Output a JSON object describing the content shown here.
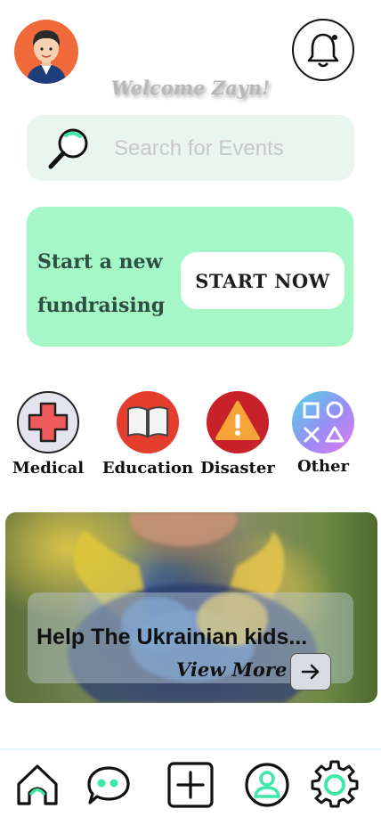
{
  "header": {
    "welcome_text": "Welcome Zayn!",
    "avatar_icon": "user-avatar",
    "notification_icon": "bell-icon"
  },
  "search": {
    "placeholder": "Search for Events",
    "icon": "search-icon"
  },
  "fundraising": {
    "text": "Start a new fundraising",
    "button_label": "START NOW",
    "background": "#a6f7c8"
  },
  "categories": [
    {
      "label": "Medical",
      "icon": "medical-cross-icon",
      "color": "#ef5a5a"
    },
    {
      "label": "Education",
      "icon": "book-icon",
      "color": "#e53d2e"
    },
    {
      "label": "Disaster",
      "icon": "warning-icon",
      "color": "#c8212a"
    },
    {
      "label": "Other",
      "icon": "playstation-shapes-icon",
      "color": "#8aa6f5"
    }
  ],
  "banner": {
    "title": "Help The Ukrainian kids...",
    "link_label": "View More",
    "arrow_icon": "arrow-right-icon"
  },
  "bottom_nav": [
    {
      "name": "home",
      "icon": "home-icon",
      "active": true
    },
    {
      "name": "chat",
      "icon": "chat-icon",
      "active": false
    },
    {
      "name": "add",
      "icon": "plus-square-icon",
      "active": false
    },
    {
      "name": "profile",
      "icon": "profile-icon",
      "active": false
    },
    {
      "name": "settings",
      "icon": "gear-icon",
      "active": false
    }
  ],
  "colors": {
    "accent": "#3ee8a6",
    "search_bg": "#e9f5ef"
  }
}
